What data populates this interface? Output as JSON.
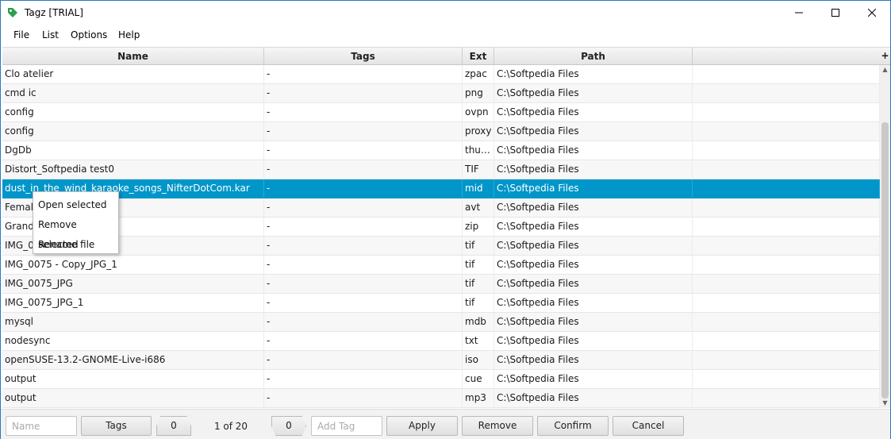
{
  "window": {
    "title": "Tagz [TRIAL]",
    "accent": "#0096c9"
  },
  "menu": [
    "File",
    "List",
    "Options",
    "Help"
  ],
  "table": {
    "columns": [
      "Name",
      "Tags",
      "Ext",
      "Path"
    ],
    "corner": "+",
    "rows": [
      {
        "name": "Clo atelier",
        "tags": "-",
        "ext": "zpac",
        "path": "C:\\Softpedia Files"
      },
      {
        "name": "cmd ic",
        "tags": "-",
        "ext": "png",
        "path": "C:\\Softpedia Files"
      },
      {
        "name": "config",
        "tags": "-",
        "ext": "ovpn",
        "path": "C:\\Softpedia Files"
      },
      {
        "name": "config",
        "tags": "-",
        "ext": "proxy",
        "path": "C:\\Softpedia Files"
      },
      {
        "name": "DgDb",
        "tags": "-",
        "ext": "thu…",
        "path": "C:\\Softpedia Files"
      },
      {
        "name": "Distort_Softpedia test0",
        "tags": "-",
        "ext": "TIF",
        "path": "C:\\Softpedia Files"
      },
      {
        "name": "dust_in_the_wind_karaoke_songs_NifterDotCom.kar",
        "tags": "-",
        "ext": "mid",
        "path": "C:\\Softpedia Files",
        "selected": true
      },
      {
        "name": "Female",
        "tags": "-",
        "ext": "avt",
        "path": "C:\\Softpedia Files"
      },
      {
        "name": "Grand … (U)",
        "tags": "-",
        "ext": "zip",
        "path": "C:\\Softpedia Files"
      },
      {
        "name": "IMG_00",
        "tags": "-",
        "ext": "tif",
        "path": "C:\\Softpedia Files"
      },
      {
        "name": "IMG_0075 - Copy_JPG_1",
        "tags": "-",
        "ext": "tif",
        "path": "C:\\Softpedia Files"
      },
      {
        "name": "IMG_0075_JPG",
        "tags": "-",
        "ext": "tif",
        "path": "C:\\Softpedia Files"
      },
      {
        "name": "IMG_0075_JPG_1",
        "tags": "-",
        "ext": "tif",
        "path": "C:\\Softpedia Files"
      },
      {
        "name": "mysql",
        "tags": "-",
        "ext": "mdb",
        "path": "C:\\Softpedia Files"
      },
      {
        "name": "nodesync",
        "tags": "-",
        "ext": "txt",
        "path": "C:\\Softpedia Files"
      },
      {
        "name": "openSUSE-13.2-GNOME-Live-i686",
        "tags": "-",
        "ext": "iso",
        "path": "C:\\Softpedia Files"
      },
      {
        "name": "output",
        "tags": "-",
        "ext": "cue",
        "path": "C:\\Softpedia Files"
      },
      {
        "name": "output",
        "tags": "-",
        "ext": "mp3",
        "path": "C:\\Softpedia Files"
      }
    ]
  },
  "context_menu": [
    "Open selected",
    "Remove selected",
    "Rename file"
  ],
  "bottom": {
    "name_placeholder": "Name",
    "tags_button": "Tags",
    "count_left": "0",
    "pager": "1 of 20",
    "count_right": "0",
    "addtag_placeholder": "Add Tag",
    "apply": "Apply",
    "remove": "Remove",
    "confirm": "Confirm",
    "cancel": "Cancel"
  }
}
